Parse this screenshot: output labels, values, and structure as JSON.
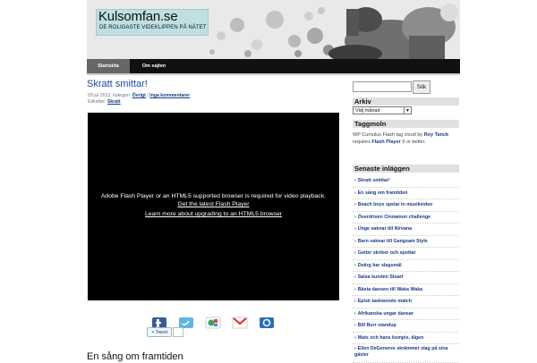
{
  "header": {
    "title": "Kulsomfan.se",
    "tagline": "DE ROLIGASTE VIDEKLIPPEN PÅ NÄTET"
  },
  "nav": [
    {
      "label": "Startsida"
    },
    {
      "label": "Om sajten"
    }
  ],
  "post": {
    "title": "Skratt smittar!",
    "meta_prefix": "03 jul 2013, kategori:",
    "meta_category": "Övrigt",
    "meta_sep": "|",
    "meta_comments": "Inga kommentarer",
    "tags_prefix": "Etiketter:",
    "tags_value": "Skratt",
    "video": {
      "message": "Adobe Flash Player or an HTML5 supported browser is required for video playback.",
      "link1": "Get the latest Flash Player",
      "link2": "Learn more about upgrading to an HTML5 browser"
    },
    "share_icons": [
      "facebook-icon",
      "twitter-icon",
      "google-icon",
      "gmail-icon",
      "email-icon"
    ],
    "tweet_label": "Tweet"
  },
  "next_post_title": "En sång om framtiden",
  "sidebar": {
    "search_button": "Sök",
    "archive_heading": "Arkiv",
    "archive_select": "Välj månad",
    "tagcloud_heading": "Taggmoln",
    "tagcloud_text1": "WP Cumulus Flash tag cloud by",
    "tagcloud_link1": "Roy Tanck",
    "tagcloud_text2": "requires",
    "tagcloud_link2": "Flash Player",
    "tagcloud_text3": "9 or better.",
    "recent_heading": "Senaste inläggen",
    "recent": [
      "Skratt smittar!",
      "En sång om framtiden",
      "Beach boys spelar in musikvideo",
      "Överdriven Cinnamon challenge",
      "Unge vaknar till Nirvana",
      "Barn vaknar till Gangsam Style",
      "Getter skriker och spottar",
      "Dvärg bar slagsmål",
      "Salsa kunden Stuart",
      "Bästa dansen till Waka Waka",
      "Episk taekwondo match",
      "Afrikanska ungar dansar",
      "Bill Burr standup",
      "Mats och hans kompis, ålgen",
      "Ellen DeGeneres skrämmer slag på sina gäster"
    ]
  },
  "colors": {
    "link": "#1a4aa0",
    "nav_bg": "#111111",
    "nav_active": "#666666",
    "logo_bg": "#bfe0e0"
  }
}
